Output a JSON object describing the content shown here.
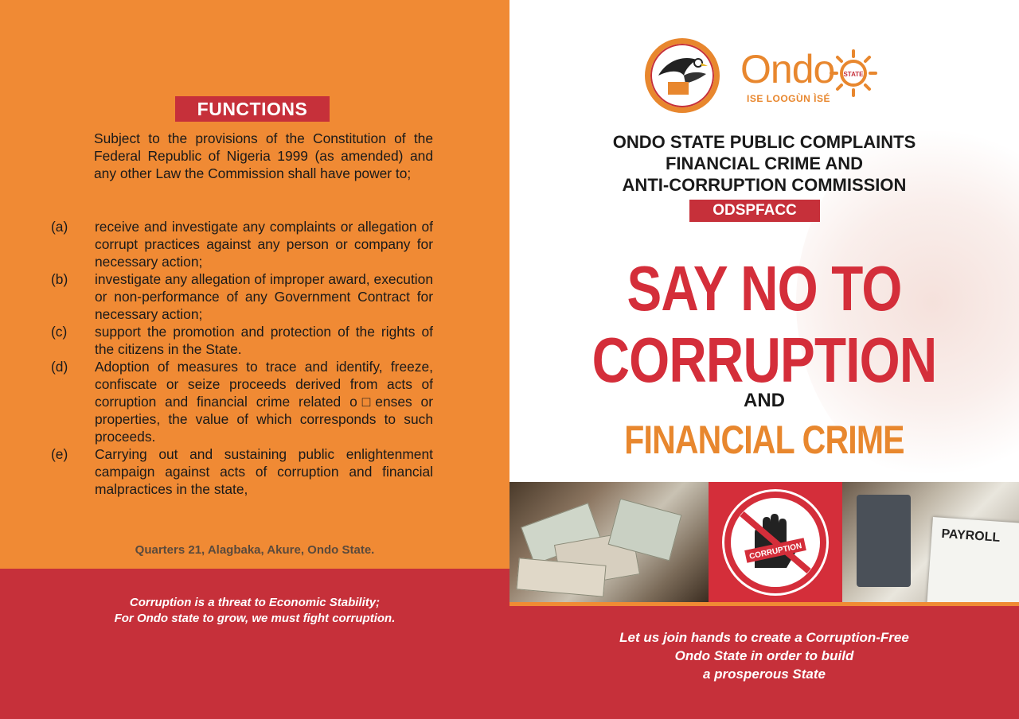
{
  "colors": {
    "orange": "#f08a34",
    "red": "#c6303a",
    "headline_red": "#d42e3a",
    "text_dark": "#1a1a1a"
  },
  "left_panel": {
    "heading": "FUNCTIONS",
    "intro": "Subject to the provisions of the Constitution of the Federal Republic of Nigeria 1999 (as amended) and any other Law the Commission shall have power to;",
    "functions": [
      {
        "letter": "(a)",
        "text": "receive and investigate any complaints or allegation of corrupt practices against any person or company for necessary action;"
      },
      {
        "letter": "(b)",
        "text": "investigate any allegation of improper award, execution or non-performance of any Government Contract for necessary action;"
      },
      {
        "letter": "(c)",
        "text": "support the promotion and protection of the rights of the citizens in the State."
      },
      {
        "letter": "(d)",
        "text": "Adoption of measures to trace and identify, freeze, confiscate  or seize proceeds derived from acts of corruption and financial crime related o□enses or properties, the value of which corresponds to such proceeds."
      },
      {
        "letter": "(e)",
        "text": "Carrying out and sustaining public enlightenment campaign against acts of corruption and financial malpractices in the state,"
      }
    ],
    "address": "Quarters 21, Alagbaka, Akure, Ondo State.",
    "quote_line1": "Corruption is a threat to Economic Stability;",
    "quote_line2": "For Ondo state to grow, we must fight corruption."
  },
  "right_panel": {
    "logo_ondo_word": "Ondo",
    "logo_ondo_state": "STATE",
    "logo_ondo_motto": "ISE LOOGÙN ÌSÉ",
    "seal_caption": "CORRUPTION",
    "title_line1": "ONDO STATE PUBLIC COMPLAINTS",
    "title_line2": "FINANCIAL CRIME AND",
    "title_line3": "ANTI-CORRUPTION COMMISSION",
    "acronym": "ODSPFACC",
    "headline_line1": "SAY NO TO",
    "headline_line2": "CORRUPTION",
    "and_word": "AND",
    "headline_line3": "FINANCIAL CRIME",
    "payroll_label": "PAYROLL",
    "quote_line1": "Let us join hands to create a Corruption-Free",
    "quote_line2": "Ondo State in order to build",
    "quote_line3": "a prosperous State"
  }
}
